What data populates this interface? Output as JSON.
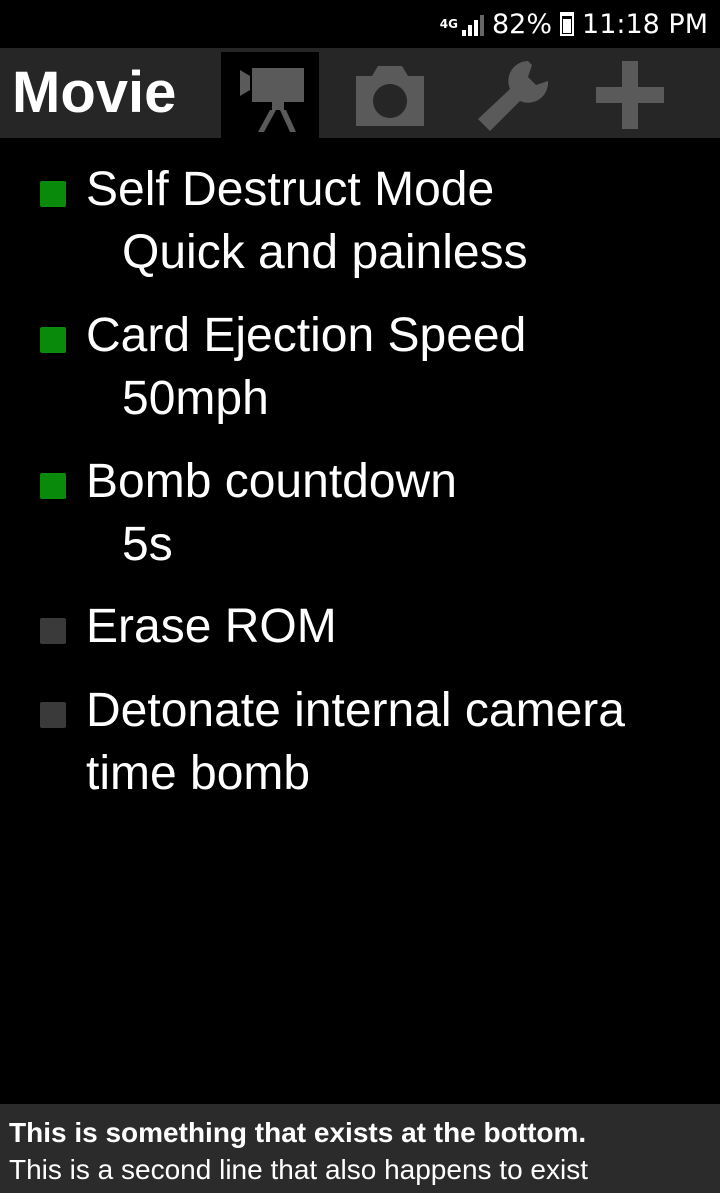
{
  "status_bar": {
    "network": "4G",
    "battery_percent": "82%",
    "time": "11:18 PM"
  },
  "header": {
    "title": "Movie",
    "tabs": [
      {
        "icon": "movie-camera-icon",
        "active": true
      },
      {
        "icon": "camera-icon",
        "active": false
      },
      {
        "icon": "wrench-icon",
        "active": false
      },
      {
        "icon": "plus-icon",
        "active": false
      }
    ]
  },
  "settings": [
    {
      "label": "Self Destruct Mode",
      "value": "Quick and painless",
      "enabled": true
    },
    {
      "label": "Card Ejection Speed",
      "value": "50mph",
      "enabled": true
    },
    {
      "label": "Bomb countdown",
      "value": "5s",
      "enabled": true
    },
    {
      "label": "Erase ROM",
      "value": "",
      "enabled": false
    },
    {
      "label": "Detonate internal camera",
      "label_line2": "time bomb",
      "value": "",
      "enabled": false
    }
  ],
  "footer": {
    "line1": "This is something that exists at the bottom.",
    "line2": "This is a second line that also happens to exist"
  },
  "colors": {
    "background": "#000000",
    "header_bg": "#262626",
    "bullet_on": "#0a8a0a",
    "bullet_off": "#3a3a3a",
    "footer_bg": "#2b2b2b",
    "tab_icon_inactive": "#5a5a5a"
  }
}
